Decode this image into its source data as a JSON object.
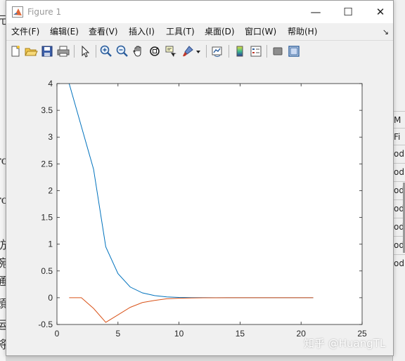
{
  "window": {
    "title": "Figure 1",
    "minimize_glyph": "—",
    "maximize_glyph": "☐",
    "close_glyph": "✕"
  },
  "menu": {
    "items": [
      "文件(F)",
      "编辑(E)",
      "查看(V)",
      "插入(I)",
      "工具(T)",
      "桌面(D)",
      "窗口(W)",
      "帮助(H)"
    ],
    "dock_glyph": "↘"
  },
  "toolbar": {
    "icons": [
      "new-figure-icon",
      "open-icon",
      "save-icon",
      "print-icon",
      "pointer-icon",
      "zoom-in-icon",
      "zoom-out-icon",
      "pan-icon",
      "rotate-3d-icon",
      "data-cursor-icon",
      "brush-icon",
      "brush-dropdown-icon",
      "link-plot-icon",
      "colorbar-icon",
      "legend-icon",
      "hide-plot-tools-icon",
      "show-plot-tools-icon"
    ]
  },
  "background": {
    "left_chars": [
      "元",
      "ro",
      "ro",
      "妨",
      "碗",
      "通",
      "頭",
      "运",
      "将"
    ],
    "right_chars": [
      "M",
      "Fi",
      "od",
      "od",
      "od",
      "od",
      "od",
      "od",
      "od"
    ]
  },
  "watermark": "知乎 @HuangTL",
  "colors": {
    "series1": "#0072BD",
    "series2": "#D95319"
  },
  "chart_data": {
    "type": "line",
    "title": "",
    "xlabel": "",
    "ylabel": "",
    "xlim": [
      0,
      25
    ],
    "ylim": [
      -0.5,
      4
    ],
    "xticks": [
      0,
      5,
      10,
      15,
      20,
      25
    ],
    "yticks": [
      -0.5,
      0,
      0.5,
      1,
      1.5,
      2,
      2.5,
      3,
      3.5,
      4
    ],
    "ytick_labels": [
      "-0.5",
      "0",
      "0.5",
      "1",
      "1.5",
      "2",
      "2.5",
      "3",
      "3.5",
      "4"
    ],
    "grid": false,
    "series": [
      {
        "color": "#0072BD",
        "x": [
          1,
          2,
          3,
          4,
          5,
          6,
          7,
          8,
          9,
          10,
          11,
          12,
          13,
          14,
          15,
          16,
          17,
          18,
          19,
          20,
          21
        ],
        "values": [
          4.0,
          3.2,
          2.4,
          0.95,
          0.45,
          0.2,
          0.09,
          0.04,
          0.015,
          0.005,
          0.002,
          0.001,
          0,
          0,
          0,
          0,
          0,
          0,
          0,
          0,
          0
        ]
      },
      {
        "color": "#D95319",
        "x": [
          1,
          2,
          3,
          4,
          5,
          6,
          7,
          8,
          9,
          10,
          11,
          12,
          13,
          14,
          15,
          16,
          17,
          18,
          19,
          20,
          21
        ],
        "values": [
          0,
          0,
          -0.2,
          -0.46,
          -0.32,
          -0.18,
          -0.09,
          -0.05,
          -0.02,
          -0.01,
          -0.004,
          -0.002,
          -0.001,
          0,
          0,
          0,
          0,
          0,
          0,
          0,
          0
        ]
      }
    ]
  }
}
